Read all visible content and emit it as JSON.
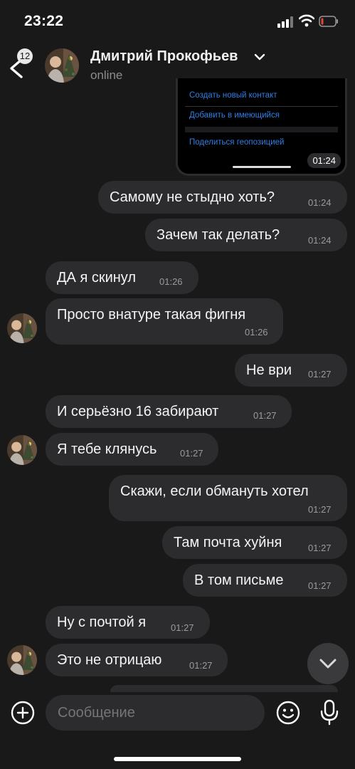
{
  "status_bar": {
    "time": "23:22"
  },
  "header": {
    "back_badge": "12",
    "contact_name": "Дмитрий Прокофьев",
    "status": "online"
  },
  "shared_card": {
    "items": [
      "Создать новый контакт",
      "Добавить в имеющийся",
      "Поделиться геопозицией"
    ],
    "time": "01:24"
  },
  "messages": [
    {
      "text": "Самому не стыдно хоть?",
      "time": "01:24",
      "side": "out"
    },
    {
      "text": "Зачем так делать?",
      "time": "01:24",
      "side": "out"
    },
    {
      "text": "ДА я скинул",
      "time": "01:26",
      "side": "in"
    },
    {
      "text": "Просто внатуре такая фигня",
      "time": "01:26",
      "side": "in"
    },
    {
      "text": "Не ври",
      "time": "01:27",
      "side": "out"
    },
    {
      "text": "И серьёзно 16 забирают",
      "time": "01:27",
      "side": "in"
    },
    {
      "text": "Я тебе клянусь",
      "time": "01:27",
      "side": "in"
    },
    {
      "text": "Скажи, если обмануть хотел",
      "time": "01:27",
      "side": "out"
    },
    {
      "text": "Там почта хуйня",
      "time": "01:27",
      "side": "out"
    },
    {
      "text": "В том письме",
      "time": "01:27",
      "side": "out"
    },
    {
      "text": "Ну с почтой я",
      "time": "01:27",
      "side": "in"
    },
    {
      "text": "Это не отрицаю",
      "time": "01:27",
      "side": "in"
    }
  ],
  "composer": {
    "placeholder": "Сообщение"
  },
  "colors": {
    "background": "#19191a",
    "bubble": "#2c2c2e",
    "link": "#2f7fe6"
  },
  "icons": [
    "back-icon",
    "chevron-down-icon",
    "plus-icon",
    "emoji-icon",
    "microphone-icon",
    "scroll-down-icon"
  ]
}
